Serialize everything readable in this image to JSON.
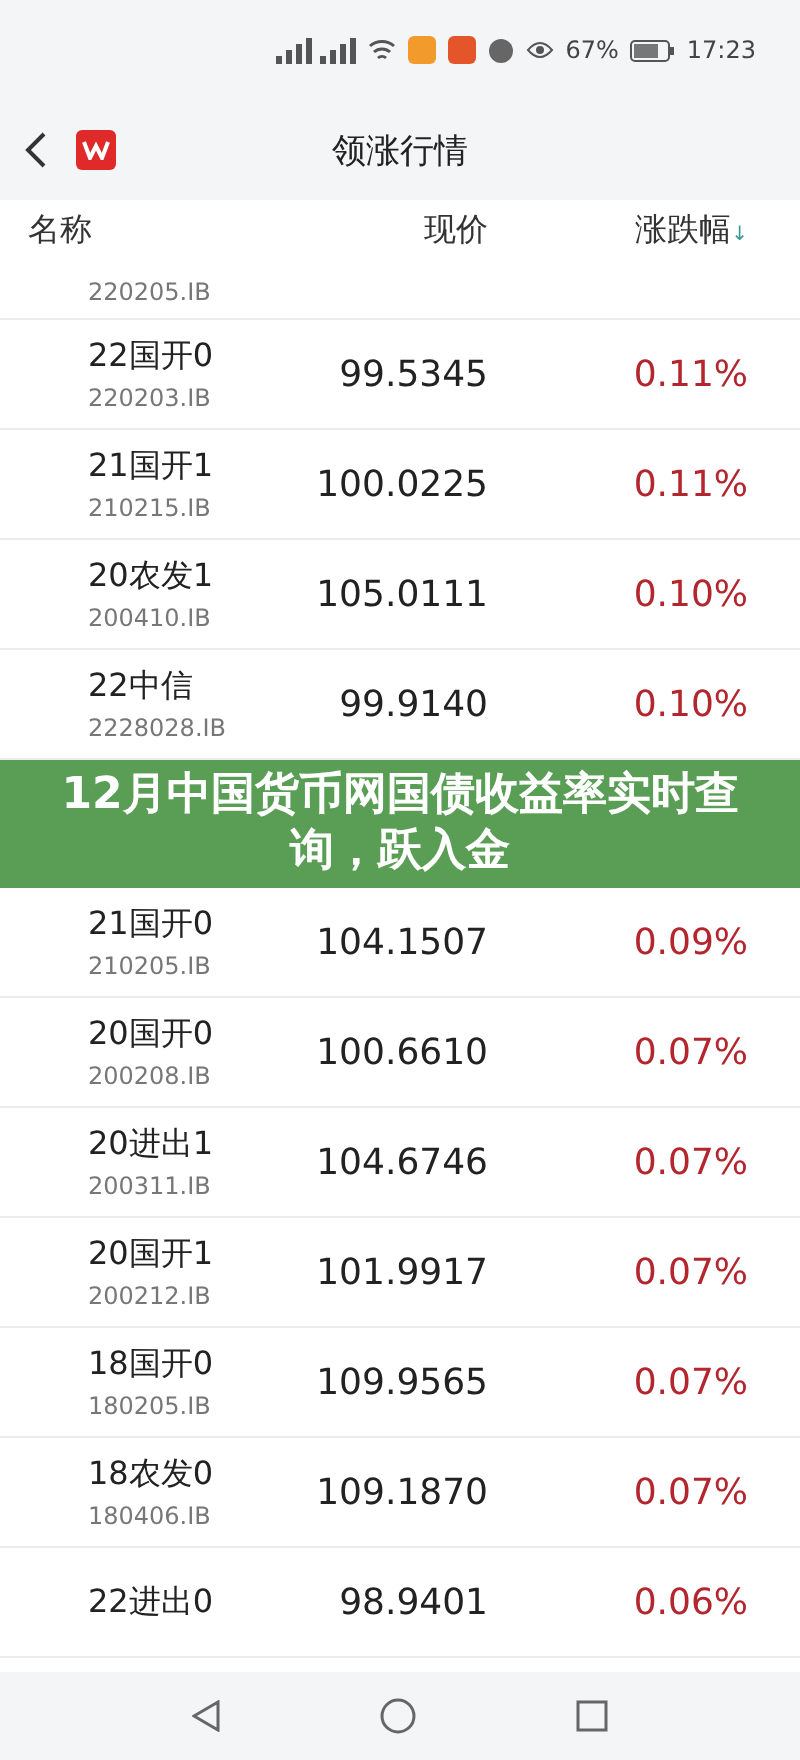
{
  "status_bar": {
    "battery_percent": "67%",
    "time": "17:23"
  },
  "header": {
    "title": "领涨行情"
  },
  "columns": [
    {
      "label": "名称"
    },
    {
      "label": "现价"
    },
    {
      "label": "涨跌幅",
      "sort_arrow": "↓"
    }
  ],
  "partial_row": {
    "code": "220205.IB"
  },
  "rows": [
    {
      "kind": "row",
      "name": "22国开0",
      "code": "220203.IB",
      "price": "99.5345",
      "change": "0.11%"
    },
    {
      "kind": "row",
      "name": "21国开1",
      "code": "210215.IB",
      "price": "100.0225",
      "change": "0.11%"
    },
    {
      "kind": "row",
      "name": "20农发1",
      "code": "200410.IB",
      "price": "105.0111",
      "change": "0.10%"
    },
    {
      "kind": "row",
      "name": "22中信",
      "code": "2228028.IB",
      "price": "99.9140",
      "change": "0.10%"
    },
    {
      "kind": "banner",
      "text": "12月中国货币网国债收益率实时查询，跃入金"
    },
    {
      "kind": "row",
      "name": "21国开0",
      "code": "210205.IB",
      "price": "104.1507",
      "change": "0.09%"
    },
    {
      "kind": "row",
      "name": "20国开0",
      "code": "200208.IB",
      "price": "100.6610",
      "change": "0.07%"
    },
    {
      "kind": "row",
      "name": "20进出1",
      "code": "200311.IB",
      "price": "104.6746",
      "change": "0.07%"
    },
    {
      "kind": "row",
      "name": "20国开1",
      "code": "200212.IB",
      "price": "101.9917",
      "change": "0.07%"
    },
    {
      "kind": "row",
      "name": "18国开0",
      "code": "180205.IB",
      "price": "109.9565",
      "change": "0.07%"
    },
    {
      "kind": "row",
      "name": "18农发0",
      "code": "180406.IB",
      "price": "109.1870",
      "change": "0.07%"
    },
    {
      "kind": "row",
      "name": "22进出0",
      "price": "98.9401",
      "change": "0.06%"
    }
  ]
}
